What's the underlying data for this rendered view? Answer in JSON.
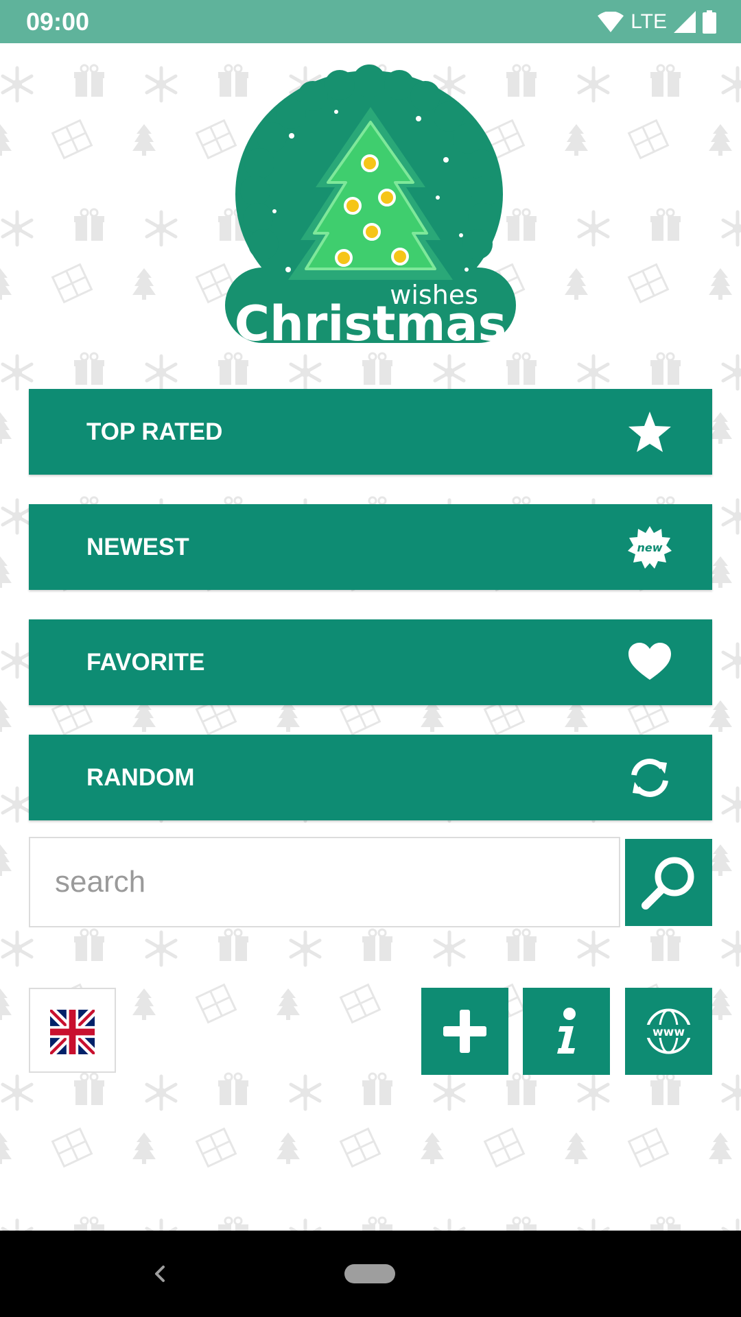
{
  "status_bar": {
    "time": "09:00",
    "network": "LTE"
  },
  "logo": {
    "small_word": "wishes",
    "big_word": "Christmas"
  },
  "menu": [
    {
      "label": "TOP RATED",
      "icon": "star-icon"
    },
    {
      "label": "NEWEST",
      "icon": "new-badge-icon"
    },
    {
      "label": "FAVORITE",
      "icon": "heart-icon"
    },
    {
      "label": "RANDOM",
      "icon": "refresh-icon"
    }
  ],
  "search": {
    "placeholder": "search",
    "value": ""
  },
  "actions": {
    "language_flag": "uk-flag-icon",
    "buttons": [
      "plus-icon",
      "info-icon",
      "www-globe-icon"
    ]
  },
  "new_badge_text": "new",
  "www_text": "www",
  "colors": {
    "primary": "#0e8c73",
    "status_bar": "#5fb39b",
    "pattern": "#e6e6e6",
    "logo_dark": "#17916f",
    "logo_light": "#3fce6e",
    "ornament": "#f5c518"
  }
}
